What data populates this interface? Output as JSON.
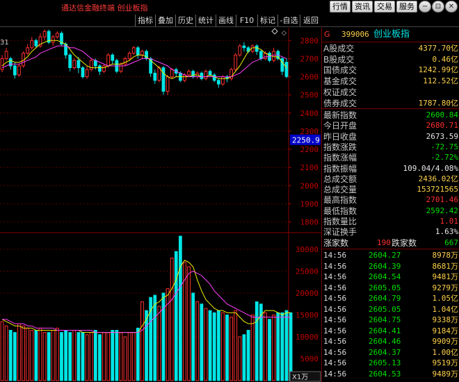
{
  "window": {
    "title": "通达信金融终端  创业板指",
    "tabs": [
      "行情",
      "资讯",
      "交易",
      "服务"
    ],
    "controls": [
      "−",
      "⊡",
      "✕"
    ]
  },
  "toolbar": {
    "items": [
      "指标",
      "叠加",
      "历史",
      "统计",
      "画线",
      "F10",
      "标记",
      "-自选",
      "返回"
    ]
  },
  "chart": {
    "top_left_label": "31",
    "price_axis_labels": [
      "2800",
      "2700",
      "2600",
      "2500",
      "2400",
      "2300",
      "2200",
      "2100",
      "2000",
      "1900",
      "1800"
    ],
    "current_price_tag": "2250.9",
    "volume_axis_labels": [
      "30000",
      "25000",
      "20000",
      "15000",
      "10000",
      "5000"
    ],
    "volume_unit": "X1万",
    "colors": {
      "up": "#ff3030",
      "down": "#00e5e5",
      "ma5": "#f0f000",
      "ma10": "#ff40ff"
    }
  },
  "chart_data": {
    "type": "candlestick",
    "price_ylim": [
      1760,
      2870
    ],
    "volume_ylim": [
      0,
      33000
    ],
    "candles": [
      {
        "o": 2640,
        "c": 2700,
        "h": 2720,
        "l": 2625
      },
      {
        "o": 2700,
        "c": 2740,
        "h": 2760,
        "l": 2690
      },
      {
        "o": 2700,
        "c": 2660,
        "h": 2710,
        "l": 2640
      },
      {
        "o": 2660,
        "c": 2610,
        "h": 2680,
        "l": 2590
      },
      {
        "o": 2610,
        "c": 2660,
        "h": 2670,
        "l": 2600
      },
      {
        "o": 2660,
        "c": 2730,
        "h": 2740,
        "l": 2650
      },
      {
        "o": 2730,
        "c": 2760,
        "h": 2780,
        "l": 2720
      },
      {
        "o": 2760,
        "c": 2800,
        "h": 2820,
        "l": 2750
      },
      {
        "o": 2800,
        "c": 2770,
        "h": 2810,
        "l": 2760
      },
      {
        "o": 2770,
        "c": 2820,
        "h": 2840,
        "l": 2760
      },
      {
        "o": 2820,
        "c": 2850,
        "h": 2860,
        "l": 2800
      },
      {
        "o": 2850,
        "c": 2790,
        "h": 2860,
        "l": 2780
      },
      {
        "o": 2790,
        "c": 2820,
        "h": 2830,
        "l": 2770
      },
      {
        "o": 2820,
        "c": 2840,
        "h": 2850,
        "l": 2810
      },
      {
        "o": 2840,
        "c": 2780,
        "h": 2850,
        "l": 2770
      },
      {
        "o": 2780,
        "c": 2720,
        "h": 2790,
        "l": 2700
      },
      {
        "o": 2720,
        "c": 2650,
        "h": 2730,
        "l": 2630
      },
      {
        "o": 2650,
        "c": 2690,
        "h": 2700,
        "l": 2640
      },
      {
        "o": 2690,
        "c": 2650,
        "h": 2710,
        "l": 2620
      },
      {
        "o": 2650,
        "c": 2600,
        "h": 2660,
        "l": 2590
      },
      {
        "o": 2600,
        "c": 2640,
        "h": 2660,
        "l": 2590
      },
      {
        "o": 2640,
        "c": 2690,
        "h": 2700,
        "l": 2630
      },
      {
        "o": 2690,
        "c": 2660,
        "h": 2700,
        "l": 2640
      },
      {
        "o": 2660,
        "c": 2630,
        "h": 2670,
        "l": 2610
      },
      {
        "o": 2630,
        "c": 2660,
        "h": 2670,
        "l": 2620
      },
      {
        "o": 2660,
        "c": 2720,
        "h": 2730,
        "l": 2650
      },
      {
        "o": 2720,
        "c": 2690,
        "h": 2730,
        "l": 2670
      },
      {
        "o": 2690,
        "c": 2630,
        "h": 2700,
        "l": 2620
      },
      {
        "o": 2630,
        "c": 2670,
        "h": 2680,
        "l": 2620
      },
      {
        "o": 2670,
        "c": 2700,
        "h": 2710,
        "l": 2660
      },
      {
        "o": 2700,
        "c": 2730,
        "h": 2740,
        "l": 2690
      },
      {
        "o": 2730,
        "c": 2760,
        "h": 2770,
        "l": 2720
      },
      {
        "o": 2760,
        "c": 2720,
        "h": 2770,
        "l": 2700
      },
      {
        "o": 2720,
        "c": 2740,
        "h": 2750,
        "l": 2700
      },
      {
        "o": 2740,
        "c": 2700,
        "h": 2750,
        "l": 2690
      },
      {
        "o": 2700,
        "c": 2620,
        "h": 2710,
        "l": 2600
      },
      {
        "o": 2620,
        "c": 2580,
        "h": 2640,
        "l": 2560
      },
      {
        "o": 2580,
        "c": 2650,
        "h": 2660,
        "l": 2570
      },
      {
        "o": 2650,
        "c": 2520,
        "h": 2660,
        "l": 2500
      },
      {
        "o": 2520,
        "c": 2600,
        "h": 2610,
        "l": 2500
      },
      {
        "o": 2600,
        "c": 2640,
        "h": 2650,
        "l": 2590
      },
      {
        "o": 2640,
        "c": 2620,
        "h": 2650,
        "l": 2600
      },
      {
        "o": 2620,
        "c": 2580,
        "h": 2630,
        "l": 2570
      },
      {
        "o": 2580,
        "c": 2610,
        "h": 2620,
        "l": 2570
      },
      {
        "o": 2610,
        "c": 2630,
        "h": 2640,
        "l": 2600
      },
      {
        "o": 2630,
        "c": 2600,
        "h": 2640,
        "l": 2590
      },
      {
        "o": 2600,
        "c": 2620,
        "h": 2630,
        "l": 2590
      },
      {
        "o": 2620,
        "c": 2590,
        "h": 2630,
        "l": 2580
      },
      {
        "o": 2590,
        "c": 2630,
        "h": 2640,
        "l": 2580
      },
      {
        "o": 2630,
        "c": 2610,
        "h": 2640,
        "l": 2600
      },
      {
        "o": 2610,
        "c": 2580,
        "h": 2620,
        "l": 2570
      },
      {
        "o": 2580,
        "c": 2560,
        "h": 2590,
        "l": 2540
      },
      {
        "o": 2560,
        "c": 2600,
        "h": 2610,
        "l": 2550
      },
      {
        "o": 2600,
        "c": 2590,
        "h": 2610,
        "l": 2570
      },
      {
        "o": 2590,
        "c": 2640,
        "h": 2650,
        "l": 2580
      },
      {
        "o": 2640,
        "c": 2720,
        "h": 2730,
        "l": 2630
      },
      {
        "o": 2720,
        "c": 2770,
        "h": 2780,
        "l": 2710
      },
      {
        "o": 2770,
        "c": 2760,
        "h": 2790,
        "l": 2740
      },
      {
        "o": 2760,
        "c": 2740,
        "h": 2770,
        "l": 2730
      },
      {
        "o": 2740,
        "c": 2770,
        "h": 2780,
        "l": 2730
      },
      {
        "o": 2770,
        "c": 2740,
        "h": 2780,
        "l": 2720
      },
      {
        "o": 2740,
        "c": 2700,
        "h": 2750,
        "l": 2690
      },
      {
        "o": 2700,
        "c": 2730,
        "h": 2740,
        "l": 2690
      },
      {
        "o": 2730,
        "c": 2690,
        "h": 2740,
        "l": 2680
      },
      {
        "o": 2690,
        "c": 2740,
        "h": 2760,
        "l": 2680
      },
      {
        "o": 2740,
        "c": 2700,
        "h": 2750,
        "l": 2690
      },
      {
        "o": 2700,
        "c": 2630,
        "h": 2710,
        "l": 2610
      },
      {
        "o": 2680,
        "c": 2601,
        "h": 2702,
        "l": 2592
      }
    ],
    "ma5": [
      2660,
      2680,
      2690,
      2680,
      2680,
      2690,
      2710,
      2740,
      2760,
      2780,
      2790,
      2800,
      2800,
      2800,
      2790,
      2780,
      2750,
      2720,
      2700,
      2680,
      2660,
      2650,
      2650,
      2650,
      2650,
      2660,
      2670,
      2670,
      2670,
      2680,
      2690,
      2710,
      2720,
      2720,
      2710,
      2690,
      2670,
      2650,
      2620,
      2600,
      2590,
      2600,
      2600,
      2600,
      2600,
      2610,
      2610,
      2600,
      2600,
      2610,
      2600,
      2590,
      2590,
      2590,
      2600,
      2630,
      2660,
      2700,
      2740,
      2760,
      2760,
      2750,
      2730,
      2720,
      2710,
      2710,
      2680,
      2650
    ],
    "ma10": [
      2650,
      2660,
      2670,
      2670,
      2670,
      2680,
      2690,
      2700,
      2710,
      2730,
      2740,
      2750,
      2760,
      2770,
      2770,
      2770,
      2760,
      2760,
      2750,
      2740,
      2720,
      2700,
      2690,
      2680,
      2670,
      2660,
      2660,
      2660,
      2660,
      2660,
      2670,
      2680,
      2690,
      2700,
      2700,
      2700,
      2690,
      2680,
      2670,
      2660,
      2640,
      2630,
      2620,
      2610,
      2600,
      2600,
      2600,
      2600,
      2600,
      2600,
      2600,
      2600,
      2600,
      2600,
      2600,
      2610,
      2620,
      2640,
      2660,
      2680,
      2690,
      2700,
      2710,
      2710,
      2720,
      2720,
      2710,
      2700
    ],
    "volumes": [
      13500,
      12500,
      11500,
      11000,
      13000,
      12500,
      12000,
      11500,
      11500,
      12000,
      11000,
      11000,
      11500,
      12000,
      11000,
      11500,
      11000,
      11500,
      11000,
      11000,
      10500,
      11000,
      11500,
      10500,
      11000,
      11000,
      11500,
      11500,
      11000,
      10000,
      11000,
      11000,
      12000,
      18000,
      16000,
      19000,
      19500,
      17000,
      20000,
      21000,
      28000,
      29500,
      33000,
      27000,
      26000,
      20000,
      18000,
      17500,
      16500,
      16000,
      15500,
      16000,
      15500,
      15000,
      14500,
      16000,
      10000,
      10500,
      11500,
      15000,
      18000,
      17500,
      15500,
      14000,
      15000,
      15500,
      15500,
      16000,
      15500
    ],
    "vol_ma5": [
      14000,
      13500,
      13000,
      12500,
      12500,
      12000,
      12000,
      12000,
      11500,
      11500,
      11500,
      11500,
      11500,
      11500,
      11500,
      11500,
      11500,
      11500,
      11500,
      11000,
      11000,
      11000,
      11000,
      11000,
      11000,
      11000,
      11000,
      11000,
      11000,
      11000,
      11000,
      11000,
      11000,
      12500,
      14000,
      16000,
      17500,
      18000,
      19000,
      19500,
      21000,
      23000,
      26000,
      27500,
      27000,
      26000,
      23000,
      20500,
      18500,
      17500,
      16500,
      16000,
      16000,
      15500,
      15500,
      15500,
      14500,
      13500,
      13000,
      13000,
      13500,
      15000,
      16000,
      16000,
      16000,
      15500,
      15000,
      15500,
      15500
    ],
    "vol_ma10": [
      14000,
      14000,
      13500,
      13000,
      13000,
      13000,
      12500,
      12500,
      12000,
      12000,
      12000,
      12000,
      12000,
      11500,
      11500,
      11500,
      11500,
      11500,
      11500,
      11500,
      11500,
      11500,
      11000,
      11000,
      11000,
      11000,
      11000,
      11000,
      11000,
      11000,
      11000,
      11000,
      11000,
      11500,
      12500,
      13500,
      14500,
      15500,
      16500,
      17500,
      18500,
      20000,
      21500,
      23000,
      24500,
      25000,
      24500,
      24000,
      23000,
      22000,
      20500,
      19500,
      18500,
      17500,
      17000,
      16500,
      16000,
      15500,
      15000,
      14500,
      14500,
      14500,
      14500,
      14500,
      14500,
      14500,
      14500,
      14500,
      14500
    ]
  },
  "panel": {
    "code": "399006",
    "name": "创业板指",
    "g_label": "G",
    "stats1": [
      {
        "label": "A股成交",
        "value": "4377.70亿",
        "color": "#ffd24a"
      },
      {
        "label": "B股成交",
        "value": "0.46亿",
        "color": "#ffd24a"
      },
      {
        "label": "国债成交",
        "value": "1242.99亿",
        "color": "#ffd24a"
      },
      {
        "label": "基金成交",
        "value": "112.52亿",
        "color": "#ffd24a"
      },
      {
        "label": "权证成交",
        "value": "",
        "color": "#ffd24a"
      },
      {
        "label": "债券成交",
        "value": "1787.80亿",
        "color": "#ffd24a"
      }
    ],
    "stats2": [
      {
        "label": "最新指数",
        "value": "2600.84",
        "color": "#00e000"
      },
      {
        "label": "今日开盘",
        "value": "2680.71",
        "color": "#ff3030"
      },
      {
        "label": "昨日收盘",
        "value": "2673.59",
        "color": "#e8e8e8"
      },
      {
        "label": "指数涨跌",
        "value": "-72.75",
        "color": "#00e000"
      },
      {
        "label": "指数涨幅",
        "value": "-2.72%",
        "color": "#00e000"
      },
      {
        "label": "指数振幅",
        "value": "109.04/4.08%",
        "color": "#e8e8e8"
      },
      {
        "label": "总成交额",
        "value": "2436.02亿",
        "color": "#ffd24a"
      },
      {
        "label": "总成交量",
        "value": "153721565",
        "color": "#ffd24a"
      },
      {
        "label": "最高指数",
        "value": "2701.46",
        "color": "#ff3030"
      },
      {
        "label": "最低指数",
        "value": "2592.42",
        "color": "#00e000"
      },
      {
        "label": "指数量比",
        "value": "1.01",
        "color": "#ff3030"
      },
      {
        "label": "深证换手",
        "value": "1.63%",
        "color": "#e8e8e8"
      }
    ],
    "rise_label": "涨家数",
    "rise_count": "190",
    "fall_label": "跌家数",
    "fall_count": "667",
    "ticks": [
      {
        "time": "14:56",
        "price": "2604.27",
        "vol": "8978万"
      },
      {
        "time": "14:56",
        "price": "2604.39",
        "vol": "8681万"
      },
      {
        "time": "14:56",
        "price": "2604.54",
        "vol": "9481万"
      },
      {
        "time": "14:56",
        "price": "2605.05",
        "vol": "9279万"
      },
      {
        "time": "14:56",
        "price": "2604.79",
        "vol": "1.05亿"
      },
      {
        "time": "14:56",
        "price": "2605.05",
        "vol": "1.04亿"
      },
      {
        "time": "14:56",
        "price": "2604.75",
        "vol": "9338万"
      },
      {
        "time": "14:56",
        "price": "2604.41",
        "vol": "9184万"
      },
      {
        "time": "14:56",
        "price": "2604.46",
        "vol": "9909万"
      },
      {
        "time": "14:56",
        "price": "2604.37",
        "vol": "1.00亿"
      },
      {
        "time": "14:56",
        "price": "2605.13",
        "vol": "9519万"
      },
      {
        "time": "14:56",
        "price": "2604.53",
        "vol": "9489万"
      }
    ]
  }
}
